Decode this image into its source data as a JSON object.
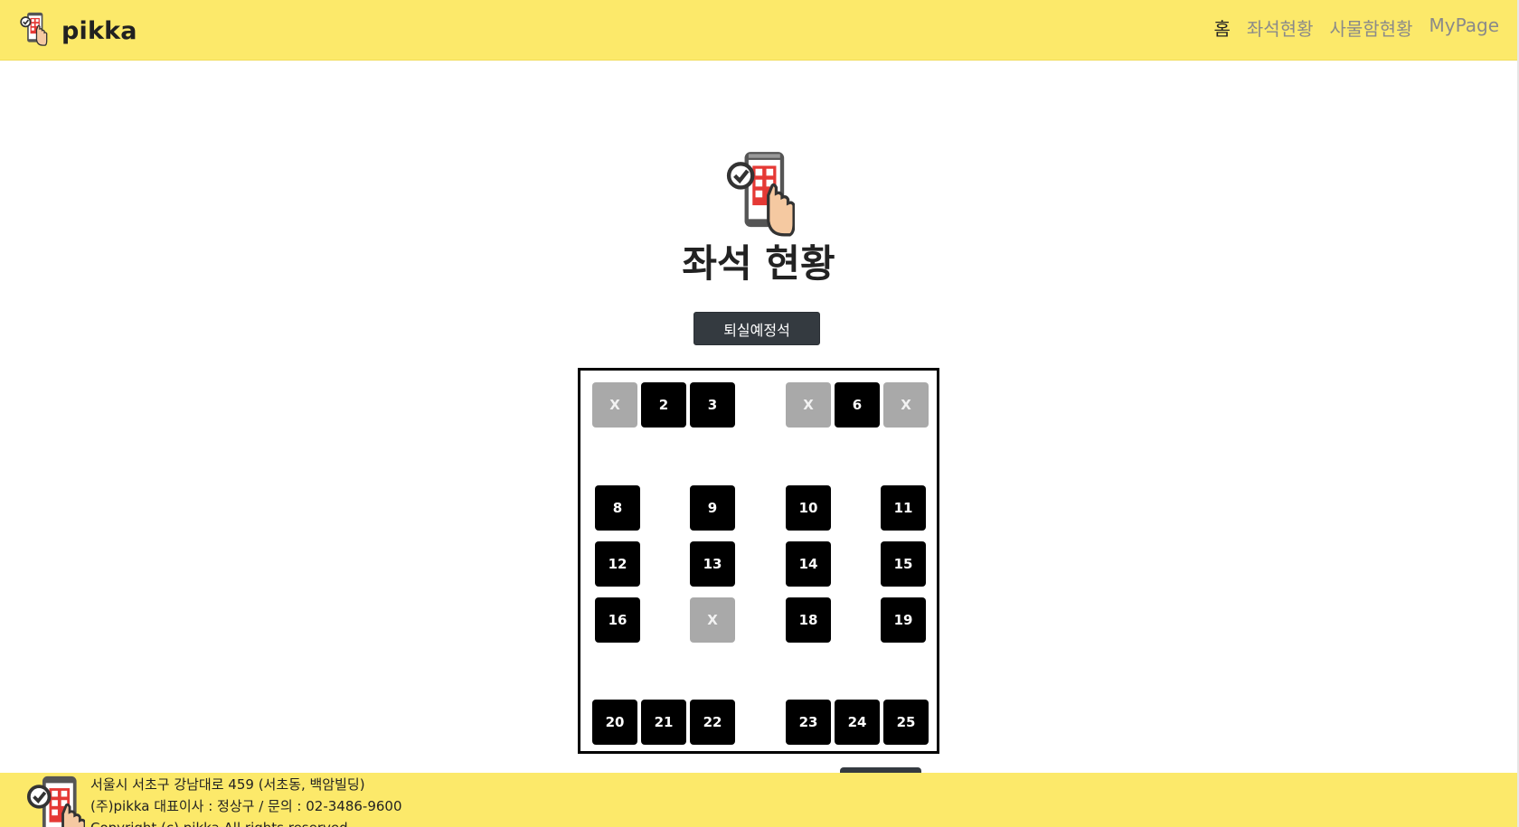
{
  "header": {
    "brand_name": "pikka",
    "logo_icon": "phone-qr-hand-icon",
    "nav": [
      {
        "label": "홈",
        "active": true
      },
      {
        "label": "좌석현황",
        "active": false
      },
      {
        "label": "사물함현황",
        "active": false
      },
      {
        "label": "MyPage",
        "active": false
      }
    ],
    "colors": {
      "bar": "#fce96a",
      "active_link": "#222222",
      "inactive_link": "#8a8a8a"
    }
  },
  "main": {
    "hero_icon": "phone-qr-hand-icon",
    "title": "좌석 현황",
    "leave_button_label": "퇴실예정석"
  },
  "seat_map": {
    "colors": {
      "available": "#000000",
      "occupied": "#a9a9a9"
    },
    "seats": [
      {
        "label": "X",
        "status": "occupied"
      },
      {
        "label": "2",
        "status": "available"
      },
      {
        "label": "3",
        "status": "available"
      },
      {
        "label": "X",
        "status": "occupied"
      },
      {
        "label": "6",
        "status": "available"
      },
      {
        "label": "X",
        "status": "occupied"
      },
      {
        "label": "8",
        "status": "available"
      },
      {
        "label": "9",
        "status": "available"
      },
      {
        "label": "10",
        "status": "available"
      },
      {
        "label": "11",
        "status": "available"
      },
      {
        "label": "12",
        "status": "available"
      },
      {
        "label": "13",
        "status": "available"
      },
      {
        "label": "14",
        "status": "available"
      },
      {
        "label": "15",
        "status": "available"
      },
      {
        "label": "16",
        "status": "available"
      },
      {
        "label": "X",
        "status": "occupied"
      },
      {
        "label": "18",
        "status": "available"
      },
      {
        "label": "19",
        "status": "available"
      },
      {
        "label": "20",
        "status": "available"
      },
      {
        "label": "21",
        "status": "available"
      },
      {
        "label": "22",
        "status": "available"
      },
      {
        "label": "23",
        "status": "available"
      },
      {
        "label": "24",
        "status": "available"
      },
      {
        "label": "25",
        "status": "available"
      }
    ]
  },
  "footer": {
    "logo_icon": "phone-qr-hand-icon",
    "address": "서울시 서초구 강남대로 459 (서초동, 백암빌딩)",
    "company": "(주)pikka 대표이사 : 정상구 / 문의 : 02-3486-9600",
    "copyright": "Copyright (c) pikka All rights reserved."
  }
}
